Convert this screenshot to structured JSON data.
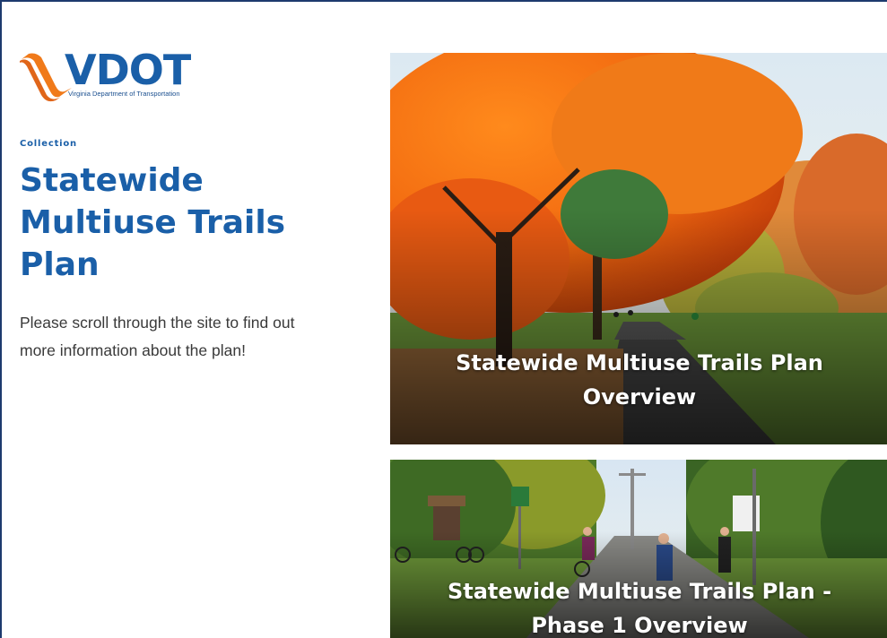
{
  "header": {
    "logo": {
      "wordmark": "VDOT",
      "subtitle": "Virginia Department of Transportation",
      "swoosh_color": "#f07a1a",
      "brand_color": "#1a5fa8"
    }
  },
  "main": {
    "collection_label": "Collection",
    "title": "Statewide Multiuse Trails Plan",
    "description": "Please scroll through the site to find out more information about the plan!"
  },
  "cards": [
    {
      "title": "Statewide Multiuse Trails Plan Overview",
      "image": "autumn-trail-photo"
    },
    {
      "title": "Statewide Multiuse Trails Plan - Phase 1 Overview",
      "image": "cyclists-trail-photo"
    }
  ],
  "colors": {
    "border": "#1d3a6e",
    "heading": "#1a5fa8",
    "body_text": "#3a3a3a"
  }
}
